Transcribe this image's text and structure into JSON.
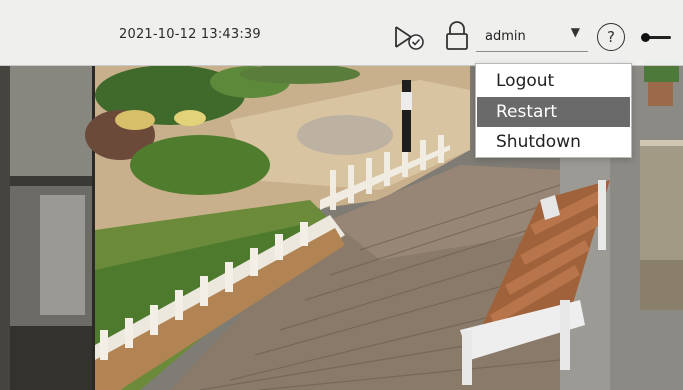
{
  "header": {
    "datetime": "2021-10-12 13:43:39"
  },
  "icons": {
    "playback": "playback-check-icon",
    "lock": "lock-icon",
    "help": "help-icon",
    "toggle": "toggle-switch-icon"
  },
  "user_menu": {
    "selected": "admin",
    "items": [
      {
        "label": "Logout",
        "active": false
      },
      {
        "label": "Restart",
        "active": true
      },
      {
        "label": "Shutdown",
        "active": false
      }
    ]
  },
  "help": {
    "label": "?"
  },
  "colors": {
    "topbar_bg": "#f8f8f8",
    "menu_highlight": "#6a6a6a",
    "menu_text": "#222222"
  }
}
